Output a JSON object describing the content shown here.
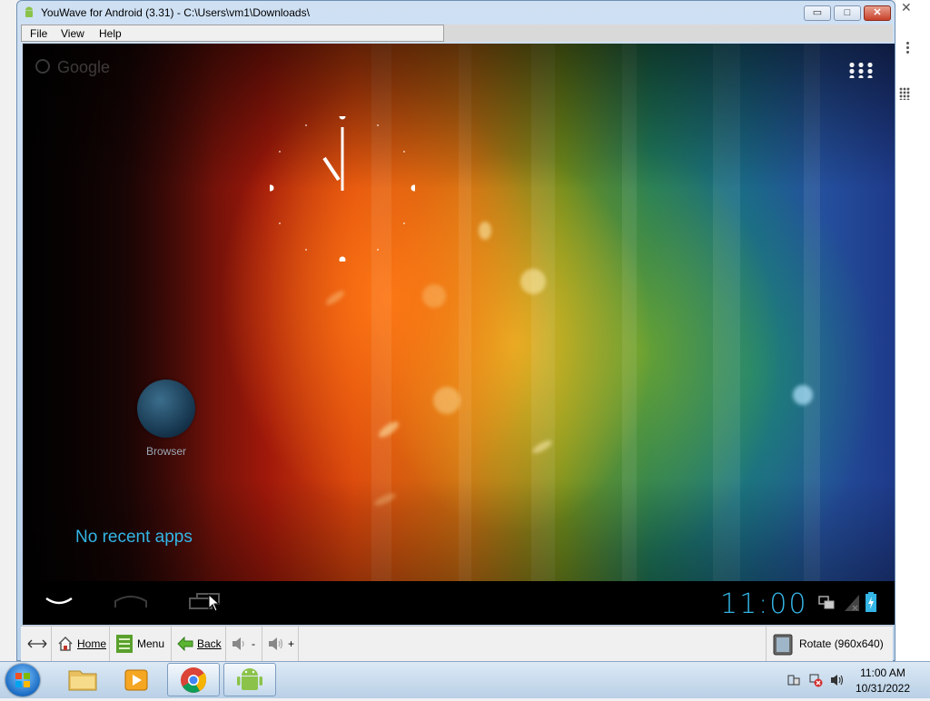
{
  "window": {
    "title": "YouWave for Android (3.31) - C:\\Users\\vm1\\Downloads\\",
    "minimize": "▭",
    "maximize": "□",
    "close": "✕"
  },
  "menubar": {
    "items": [
      {
        "label": "File"
      },
      {
        "label": "View"
      },
      {
        "label": "Help"
      }
    ]
  },
  "android": {
    "search_hint": "Google",
    "app_label": "Browser",
    "no_recent": "No recent apps",
    "status_time": "11:00"
  },
  "toolbar": {
    "home": "Home",
    "menu": "Menu",
    "back": "Back",
    "vol_down": "-",
    "vol_up": "+",
    "rotate": "Rotate (960x640)"
  },
  "taskbar": {
    "time": "11:00 AM",
    "date": "10/31/2022"
  },
  "colors": {
    "holo_blue": "#33b5e5",
    "navbar": "#000000",
    "taskbar": "#dce9f5"
  }
}
